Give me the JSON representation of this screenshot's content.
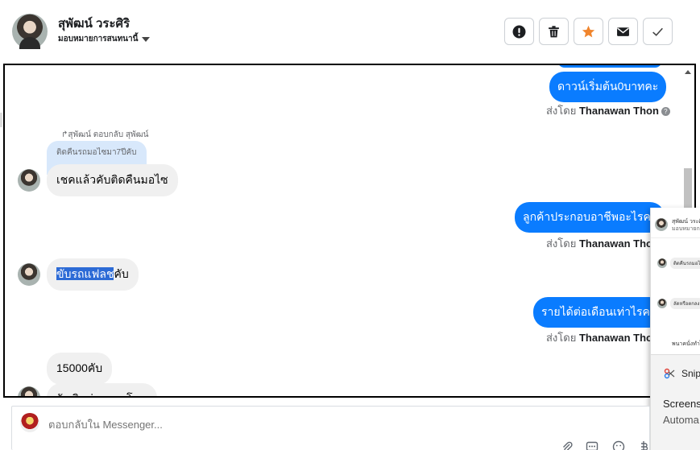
{
  "header": {
    "contact_name": "สุพัฒน์ วระศิริ",
    "assign_label": "มอบหมายการสนทนานี้",
    "buttons": [
      {
        "name": "report-spam-button",
        "icon": "exclamation-circle-icon"
      },
      {
        "name": "delete-button",
        "icon": "trash-icon"
      },
      {
        "name": "star-button",
        "icon": "star-icon",
        "color": "#f0852d"
      },
      {
        "name": "mark-unread-button",
        "icon": "envelope-icon"
      },
      {
        "name": "mark-done-button",
        "icon": "check-icon"
      }
    ]
  },
  "chat": {
    "messages": [
      {
        "dir": "out",
        "text": "ดาวน์เริ่มต้น0บาทคะ"
      },
      {
        "dir": "meta",
        "sent_by_label": "ส่งโดย",
        "sender": "Thanawan Thon"
      },
      {
        "dir": "reply_note",
        "text": "สุพัฒน์ ตอบกลับ สุพัฒน์"
      },
      {
        "dir": "quoted",
        "text": "ติดคืนรถมอไซมา7ปีคับ"
      },
      {
        "dir": "in",
        "text": "เชคแล้วคับติดคืนมอไซ"
      },
      {
        "dir": "out",
        "text": "ลูกค้าประกอบอาชีพอะไรคะ"
      },
      {
        "dir": "meta",
        "sent_by_label": "ส่งโดย",
        "sender": "Thanawan Thon"
      },
      {
        "dir": "in",
        "text_selected": "ขับรถแฟลช",
        "text_rest": "คับ"
      },
      {
        "dir": "out",
        "text": "รายได้ต่อเดือนเท่าไรคะ"
      },
      {
        "dir": "meta",
        "sent_by_label": "ส่งโดย",
        "sender": "Thanawan Thon"
      },
      {
        "dir": "in",
        "text": "15000คับ"
      },
      {
        "dir": "in",
        "text": "รับเงินผ่านการโอน"
      }
    ]
  },
  "overlay": {
    "header_name": "สุพัฒน์ วระศิ",
    "header_sub": "มอบหมายการ",
    "pill1": "ติดคืนรถมอไซ",
    "pill2": "ลัดหรือตกลง",
    "pill3": "พนาคนั่งทำไร",
    "snip_title": "Snip",
    "snip_line1": "Screens",
    "snip_line2": "Automa"
  },
  "composer": {
    "placeholder": "ตอบกลับใน Messenger..."
  },
  "colors": {
    "messenger_blue": "#0a7cff",
    "incoming_gray": "#f0f0f0",
    "selection": "#2d6bd6",
    "star_orange": "#f0852d"
  }
}
